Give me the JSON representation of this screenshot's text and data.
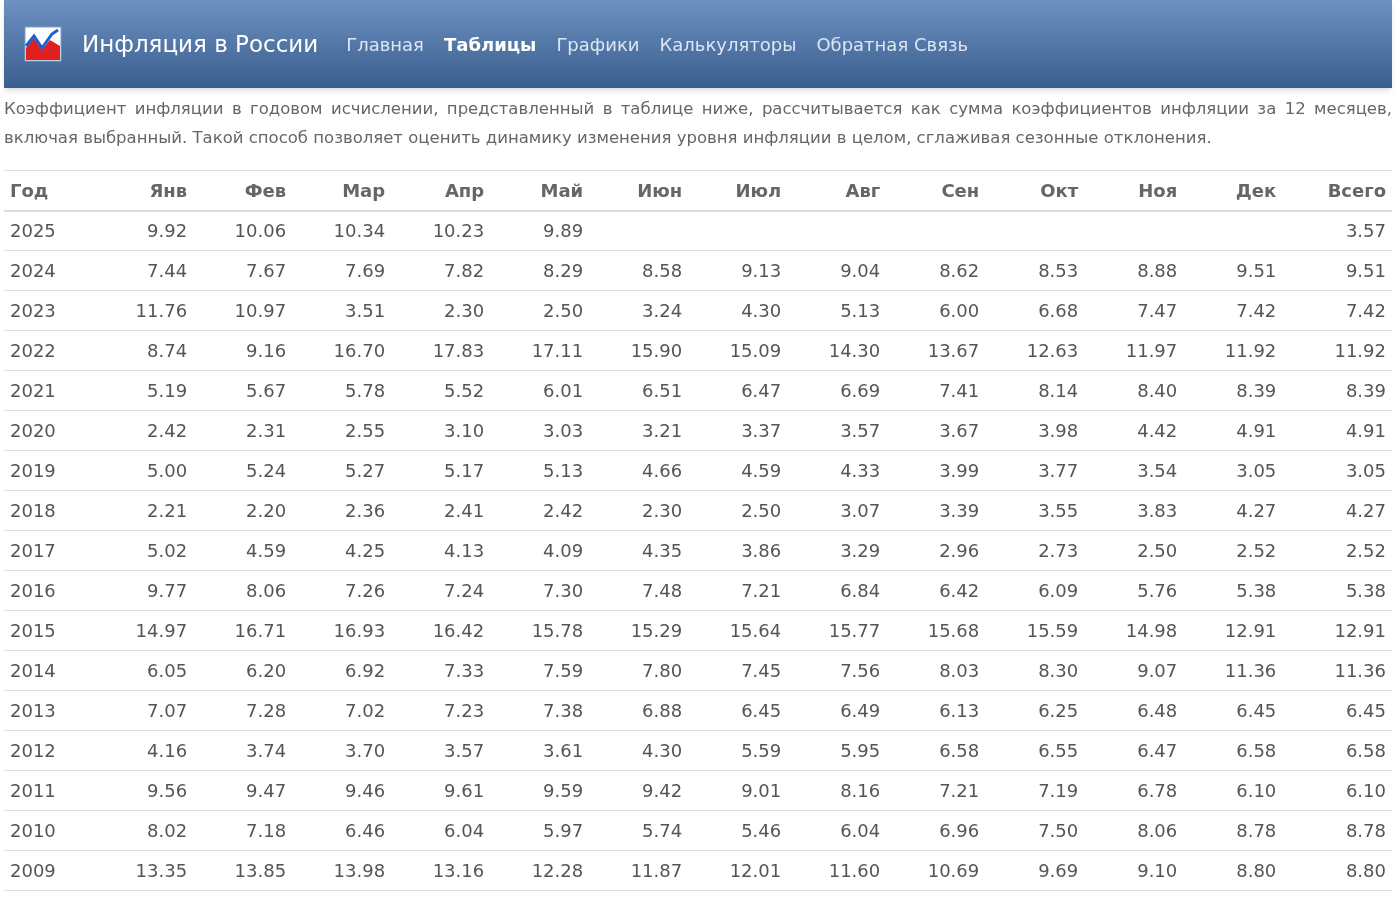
{
  "navbar": {
    "brand": "Инфляция в России",
    "items": [
      {
        "label": "Главная",
        "selected": false
      },
      {
        "label": "Таблицы",
        "selected": true
      },
      {
        "label": "Графики",
        "selected": false
      },
      {
        "label": "Калькуляторы",
        "selected": false
      },
      {
        "label": "Обратная Связь",
        "selected": false
      }
    ]
  },
  "intro": "Коэффициент инфляции в годовом исчислении, представленный в таблице ниже, рассчитывается как сумма коэффициентов инфляции за 12 месяцев, включая выбранный. Такой способ позволяет оценить динамику изменения уровня инфляции в целом, сглаживая сезонные отклонения.",
  "table": {
    "columns": [
      "Год",
      "Янв",
      "Фев",
      "Мар",
      "Апр",
      "Май",
      "Июн",
      "Июл",
      "Авг",
      "Сен",
      "Окт",
      "Ноя",
      "Дек",
      "Всего"
    ],
    "rows": [
      {
        "year": "2025",
        "months": [
          "9.92",
          "10.06",
          "10.34",
          "10.23",
          "9.89"
        ],
        "total": "3.57"
      },
      {
        "year": "2024",
        "months": [
          "7.44",
          "7.67",
          "7.69",
          "7.82",
          "8.29",
          "8.58",
          "9.13",
          "9.04",
          "8.62",
          "8.53",
          "8.88",
          "9.51"
        ],
        "total": "9.51"
      },
      {
        "year": "2023",
        "months": [
          "11.76",
          "10.97",
          "3.51",
          "2.30",
          "2.50",
          "3.24",
          "4.30",
          "5.13",
          "6.00",
          "6.68",
          "7.47",
          "7.42"
        ],
        "total": "7.42"
      },
      {
        "year": "2022",
        "months": [
          "8.74",
          "9.16",
          "16.70",
          "17.83",
          "17.11",
          "15.90",
          "15.09",
          "14.30",
          "13.67",
          "12.63",
          "11.97",
          "11.92"
        ],
        "total": "11.92"
      },
      {
        "year": "2021",
        "months": [
          "5.19",
          "5.67",
          "5.78",
          "5.52",
          "6.01",
          "6.51",
          "6.47",
          "6.69",
          "7.41",
          "8.14",
          "8.40",
          "8.39"
        ],
        "total": "8.39"
      },
      {
        "year": "2020",
        "months": [
          "2.42",
          "2.31",
          "2.55",
          "3.10",
          "3.03",
          "3.21",
          "3.37",
          "3.57",
          "3.67",
          "3.98",
          "4.42",
          "4.91"
        ],
        "total": "4.91"
      },
      {
        "year": "2019",
        "months": [
          "5.00",
          "5.24",
          "5.27",
          "5.17",
          "5.13",
          "4.66",
          "4.59",
          "4.33",
          "3.99",
          "3.77",
          "3.54",
          "3.05"
        ],
        "total": "3.05"
      },
      {
        "year": "2018",
        "months": [
          "2.21",
          "2.20",
          "2.36",
          "2.41",
          "2.42",
          "2.30",
          "2.50",
          "3.07",
          "3.39",
          "3.55",
          "3.83",
          "4.27"
        ],
        "total": "4.27"
      },
      {
        "year": "2017",
        "months": [
          "5.02",
          "4.59",
          "4.25",
          "4.13",
          "4.09",
          "4.35",
          "3.86",
          "3.29",
          "2.96",
          "2.73",
          "2.50",
          "2.52"
        ],
        "total": "2.52"
      },
      {
        "year": "2016",
        "months": [
          "9.77",
          "8.06",
          "7.26",
          "7.24",
          "7.30",
          "7.48",
          "7.21",
          "6.84",
          "6.42",
          "6.09",
          "5.76",
          "5.38"
        ],
        "total": "5.38"
      },
      {
        "year": "2015",
        "months": [
          "14.97",
          "16.71",
          "16.93",
          "16.42",
          "15.78",
          "15.29",
          "15.64",
          "15.77",
          "15.68",
          "15.59",
          "14.98",
          "12.91"
        ],
        "total": "12.91"
      },
      {
        "year": "2014",
        "months": [
          "6.05",
          "6.20",
          "6.92",
          "7.33",
          "7.59",
          "7.80",
          "7.45",
          "7.56",
          "8.03",
          "8.30",
          "9.07",
          "11.36"
        ],
        "total": "11.36"
      },
      {
        "year": "2013",
        "months": [
          "7.07",
          "7.28",
          "7.02",
          "7.23",
          "7.38",
          "6.88",
          "6.45",
          "6.49",
          "6.13",
          "6.25",
          "6.48",
          "6.45"
        ],
        "total": "6.45"
      },
      {
        "year": "2012",
        "months": [
          "4.16",
          "3.74",
          "3.70",
          "3.57",
          "3.61",
          "4.30",
          "5.59",
          "5.95",
          "6.58",
          "6.55",
          "6.47",
          "6.58"
        ],
        "total": "6.58"
      },
      {
        "year": "2011",
        "months": [
          "9.56",
          "9.47",
          "9.46",
          "9.61",
          "9.59",
          "9.42",
          "9.01",
          "8.16",
          "7.21",
          "7.19",
          "6.78",
          "6.10"
        ],
        "total": "6.10"
      },
      {
        "year": "2010",
        "months": [
          "8.02",
          "7.18",
          "6.46",
          "6.04",
          "5.97",
          "5.74",
          "5.46",
          "6.04",
          "6.96",
          "7.50",
          "8.06",
          "8.78"
        ],
        "total": "8.78"
      },
      {
        "year": "2009",
        "months": [
          "13.35",
          "13.85",
          "13.98",
          "13.16",
          "12.28",
          "11.87",
          "12.01",
          "11.60",
          "10.69",
          "9.69",
          "9.10",
          "8.80"
        ],
        "total": "8.80"
      }
    ]
  }
}
